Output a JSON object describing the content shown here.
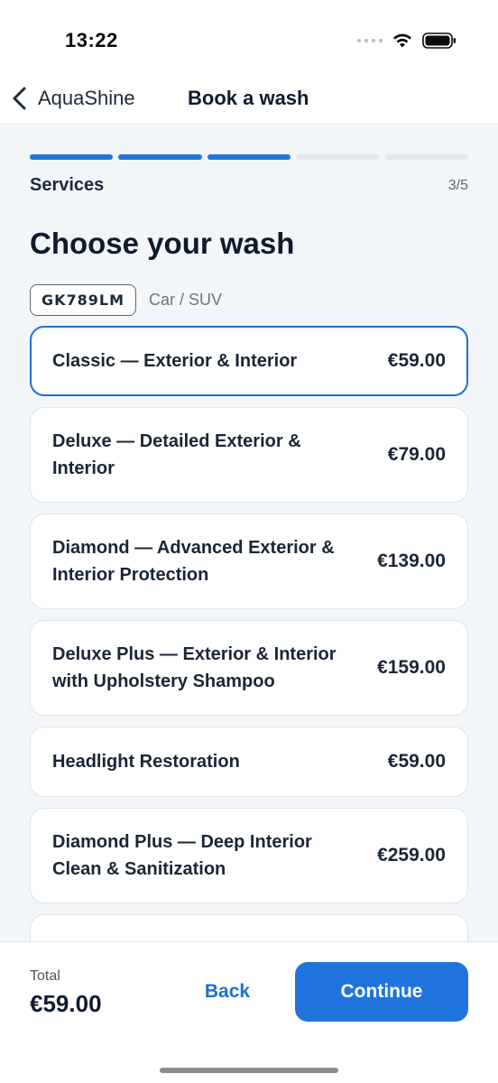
{
  "status_bar": {
    "time": "13:22",
    "icons": [
      "signal-dots-icon",
      "wifi-icon",
      "battery-icon"
    ]
  },
  "nav": {
    "back_icon": "chevron-left-icon",
    "app_name": "AquaShine",
    "title": "Book a wash"
  },
  "progress": {
    "current_step": 3,
    "total_steps": 5,
    "accent_color": "#1e74dc"
  },
  "step": {
    "label": "Services",
    "count": "3/5"
  },
  "page": {
    "title": "Choose your wash",
    "plate": "GK789LM",
    "vehicle_type": "Car / SUV"
  },
  "services": [
    {
      "name": "Classic — Exterior & Interior",
      "price": "€59.00",
      "selected": true
    },
    {
      "name": "Deluxe — Detailed Exterior & Interior",
      "price": "€79.00",
      "selected": false
    },
    {
      "name": "Diamond — Advanced Exterior & Interior Protection",
      "price": "€139.00",
      "selected": false
    },
    {
      "name": "Deluxe Plus — Exterior & Interior with Upholstery Shampoo",
      "price": "€159.00",
      "selected": false
    },
    {
      "name": "Headlight Restoration",
      "price": "€59.00",
      "selected": false
    },
    {
      "name": "Diamond Plus — Deep Interior Clean & Sanitization",
      "price": "€259.00",
      "selected": false
    }
  ],
  "footer": {
    "total_label": "Total",
    "total_value": "€59.00",
    "back_label": "Back",
    "continue_label": "Continue"
  }
}
